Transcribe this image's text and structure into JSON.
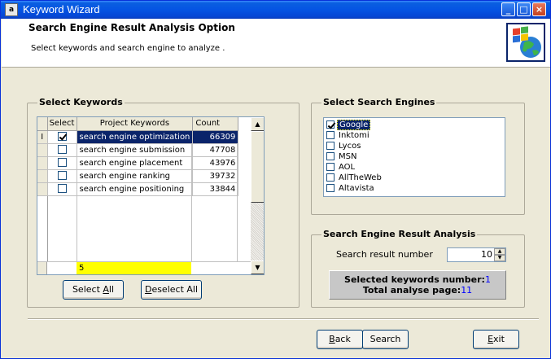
{
  "window": {
    "title": "Keyword Wizard",
    "minimize_label": "_",
    "maximize_label": "□",
    "close_label": "×",
    "app_icon_label": "a"
  },
  "header": {
    "title": "Search Engine Result Analysis Option",
    "subtitle": "Select keywords and search engine to analyze ."
  },
  "keywords": {
    "group_title": "Select Keywords",
    "columns": [
      "Select",
      "Project Keywords",
      "Count"
    ],
    "row_indicator": "I",
    "rows": [
      {
        "selected": true,
        "keyword": "search engine optimization",
        "count": "66309"
      },
      {
        "selected": false,
        "keyword": "search engine submission",
        "count": "47708"
      },
      {
        "selected": false,
        "keyword": "search engine placement",
        "count": "43976"
      },
      {
        "selected": false,
        "keyword": "search engine ranking",
        "count": "39732"
      },
      {
        "selected": false,
        "keyword": "search engine positioning",
        "count": "33844"
      }
    ],
    "footer_total": "5",
    "select_all_prefix": "Select ",
    "select_all_accel": "A",
    "select_all_suffix": "ll",
    "deselect_all_accel": "D",
    "deselect_all_suffix": "eselect All"
  },
  "engines": {
    "group_title": "Select Search Engines",
    "items": [
      {
        "label": "Google",
        "checked": true
      },
      {
        "label": "Inktomi",
        "checked": false
      },
      {
        "label": "Lycos",
        "checked": false
      },
      {
        "label": "MSN",
        "checked": false
      },
      {
        "label": "AOL",
        "checked": false
      },
      {
        "label": "AllTheWeb",
        "checked": false
      },
      {
        "label": "Altavista",
        "checked": false
      }
    ]
  },
  "analysis": {
    "group_title": "Search Engine Result Analysis",
    "result_number_label": "Search result number",
    "result_number_value": "10",
    "selected_keywords_label": "Selected keywords number:",
    "selected_keywords_value": "1",
    "total_pages_label": "Total analyse page:",
    "total_pages_value": "11"
  },
  "footer": {
    "back_accel": "B",
    "back_suffix": "ack",
    "search_label": "Search",
    "exit_accel": "E",
    "exit_suffix": "xit"
  }
}
